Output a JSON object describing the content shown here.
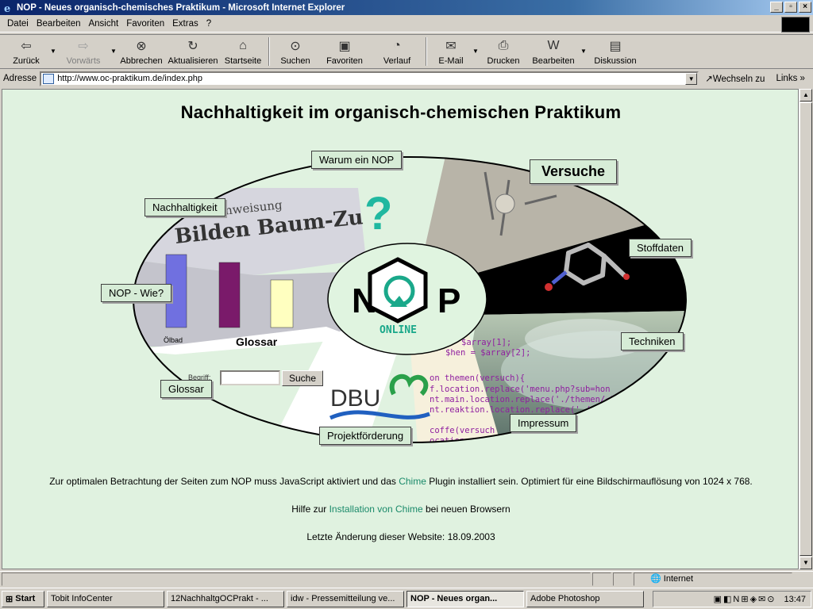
{
  "window": {
    "title": "NOP - Neues organisch-chemisches Praktikum - Microsoft Internet Explorer"
  },
  "menu": [
    "Datei",
    "Bearbeiten",
    "Ansicht",
    "Favoriten",
    "Extras",
    "?"
  ],
  "toolbar": [
    {
      "label": "Zurück",
      "icon": "back-arrow-icon",
      "disabled": false,
      "dropdown": true
    },
    {
      "label": "Vorwärts",
      "icon": "forward-arrow-icon",
      "disabled": true,
      "dropdown": true
    },
    {
      "label": "Abbrechen",
      "icon": "stop-icon",
      "disabled": false
    },
    {
      "label": "Aktualisieren",
      "icon": "refresh-icon",
      "disabled": false
    },
    {
      "label": "Startseite",
      "icon": "home-icon",
      "disabled": false
    },
    {
      "label": "Suchen",
      "icon": "search-icon",
      "disabled": false
    },
    {
      "label": "Favoriten",
      "icon": "favorites-icon",
      "disabled": false
    },
    {
      "label": "Verlauf",
      "icon": "history-icon",
      "disabled": false
    },
    {
      "label": "E-Mail",
      "icon": "mail-icon",
      "disabled": false,
      "dropdown": true
    },
    {
      "label": "Drucken",
      "icon": "print-icon",
      "disabled": false
    },
    {
      "label": "Bearbeiten",
      "icon": "edit-icon",
      "disabled": false,
      "dropdown": true
    },
    {
      "label": "Diskussion",
      "icon": "discussion-icon",
      "disabled": false
    }
  ],
  "address": {
    "label": "Adresse",
    "url": "http://www.oc-praktikum.de/index.php",
    "go": "Wechseln zu",
    "links": "Links"
  },
  "page": {
    "heading": "Nachhaltigkeit im organisch-chemischen Praktikum",
    "labels": {
      "warum": "Warum ein NOP",
      "versuche": "Versuche",
      "nachhaltigkeit": "Nachhaltigkeit",
      "stoffdaten": "Stoffdaten",
      "nopwie": "NOP - Wie?",
      "techniken": "Techniken",
      "glossar_label": "Glossar",
      "glossar_box": "Glossar",
      "projekt": "Projektförderung",
      "impressum": "Impressum"
    },
    "logo": {
      "text_n": "N",
      "text_p": "P",
      "online": "ONLINE",
      "question": "?"
    },
    "chart_text": {
      "oelbad": "Ölbad"
    },
    "search": {
      "label": "Begriff:",
      "button": "Suche"
    },
    "dbu": "DBU",
    "code_lines": [
      "$array[1];",
      "$hen = $array[2];",
      "",
      "on themen(versuch){",
      "f.location.replace('menu.php?sub=hon",
      "nt.main.location.replace('./themen/<?p",
      "nt.reaktion.location.replace('./re",
      "",
      "coffe(versuch",
      "ocation.repl"
    ],
    "footer": {
      "line1_a": "Zur optimalen Betrachtung der Seiten zum NOP muss JavaScript aktiviert und das ",
      "line1_link": "Chime",
      "line1_b": " Plugin installiert sein. Optimiert für eine Bildschirmauflösung von 1024 x 768.",
      "line2_a": "Hilfe zur ",
      "line2_link": "Installation von Chime",
      "line2_b": " bei neuen Browsern",
      "line3": "Letzte Änderung dieser Website: 18.09.2003"
    }
  },
  "status": {
    "zone": "Internet"
  },
  "taskbar": {
    "start": "Start",
    "tasks": [
      {
        "label": "Tobit InfoCenter",
        "active": false
      },
      {
        "label": "12NachhaltgOCPrakt - ...",
        "active": false
      },
      {
        "label": "idw - Pressemitteilung ve...",
        "active": false
      },
      {
        "label": "NOP - Neues organ...",
        "active": true
      },
      {
        "label": "Adobe Photoshop",
        "active": false
      }
    ],
    "clock": "13:47"
  }
}
